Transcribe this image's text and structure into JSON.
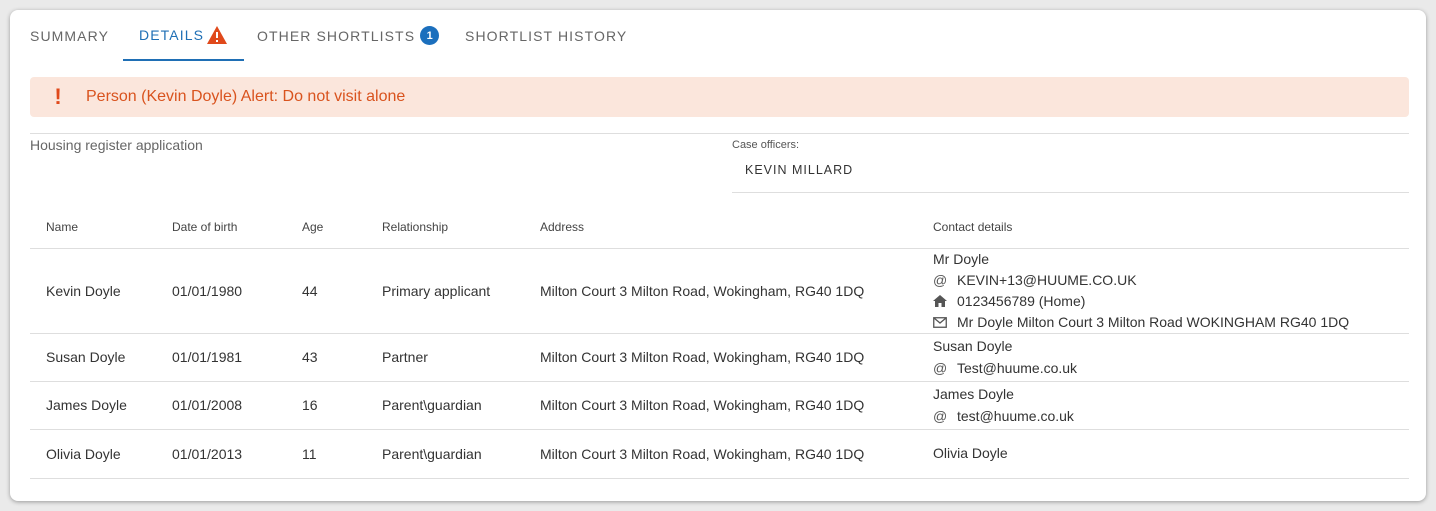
{
  "tabs": [
    {
      "label": "SUMMARY"
    },
    {
      "label": "DETAILS"
    },
    {
      "label": "OTHER SHORTLISTS",
      "badge": "1"
    },
    {
      "label": "SHORTLIST HISTORY"
    }
  ],
  "alert": {
    "message": "Person (Kevin Doyle) Alert: Do not visit alone",
    "icon": "!"
  },
  "application": {
    "title": "Housing register application",
    "case_officers_label": "Case officers:",
    "case_officer": "KEVIN MILLARD"
  },
  "table": {
    "headers": [
      "Name",
      "Date of birth",
      "Age",
      "Relationship",
      "Address",
      "Contact details"
    ],
    "rows": [
      {
        "name": "Kevin Doyle",
        "dob": "01/01/1980",
        "age": "44",
        "relationship": "Primary applicant",
        "address": "Milton Court 3 Milton Road, Wokingham, RG40 1DQ",
        "contact_name": "Mr Doyle",
        "email": "KEVIN+13@HUUME.CO.UK",
        "phone": "0123456789 (Home)",
        "postal": "Mr Doyle Milton Court 3 Milton Road WOKINGHAM RG40 1DQ"
      },
      {
        "name": "Susan Doyle",
        "dob": "01/01/1981",
        "age": "43",
        "relationship": "Partner",
        "address": "Milton Court 3 Milton Road, Wokingham, RG40 1DQ",
        "contact_name": "Susan Doyle",
        "email": "Test@huume.co.uk"
      },
      {
        "name": "James Doyle",
        "dob": "01/01/2008",
        "age": "16",
        "relationship": "Parent\\guardian",
        "address": "Milton Court 3 Milton Road, Wokingham, RG40 1DQ",
        "contact_name": "James Doyle",
        "email": "test@huume.co.uk"
      },
      {
        "name": "Olivia Doyle",
        "dob": "01/01/2013",
        "age": "11",
        "relationship": "Parent\\guardian",
        "address": "Milton Court 3 Milton Road, Wokingham, RG40 1DQ",
        "contact_name": "Olivia Doyle"
      }
    ]
  },
  "colors": {
    "accent": "#1f6fb5",
    "alert_bg": "#fbe6dc",
    "alert_text": "#d9531e",
    "warning": "#e0491b"
  },
  "icons": {
    "email": "at-icon",
    "phone": "home-icon",
    "postal": "mail-icon",
    "warning": "warning-triangle-icon"
  }
}
